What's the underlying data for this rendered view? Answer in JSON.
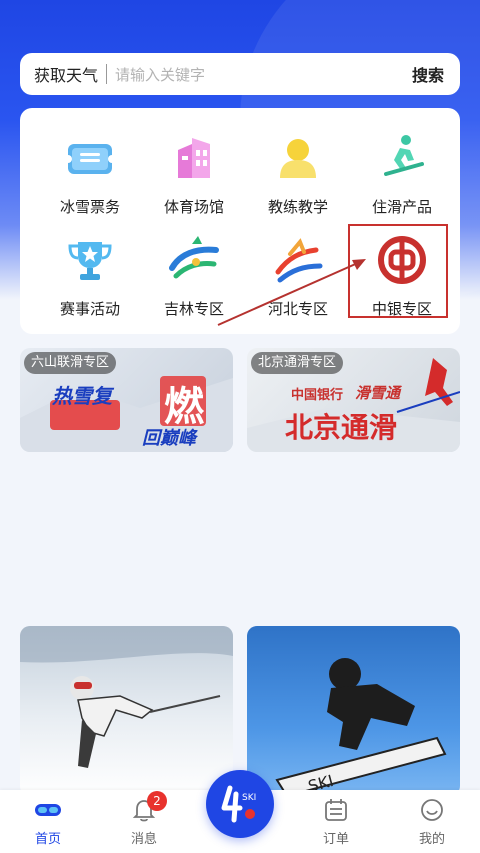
{
  "search": {
    "weather_label": "获取天气",
    "placeholder": "请输入关键字",
    "button_label": "搜索"
  },
  "grid": {
    "items": [
      {
        "label": "冰雪票务",
        "icon": "ticket-icon"
      },
      {
        "label": "体育场馆",
        "icon": "stadium-icon"
      },
      {
        "label": "教练教学",
        "icon": "coach-icon"
      },
      {
        "label": "住滑产品",
        "icon": "skier-icon"
      },
      {
        "label": "赛事活动",
        "icon": "trophy-icon"
      },
      {
        "label": "吉林专区",
        "icon": "jilin-logo-icon"
      },
      {
        "label": "河北专区",
        "icon": "hebei-logo-icon"
      },
      {
        "label": "中银专区",
        "icon": "boc-logo-icon"
      }
    ]
  },
  "banners": [
    {
      "tag": "六山联滑专区",
      "line1": "热雪复",
      "line2": "燃",
      "line3": "回巅峰"
    },
    {
      "tag": "北京通滑专区",
      "line1": "中国银行",
      "line2": "滑雪通",
      "line3": "北京通滑"
    }
  ],
  "tabbar": {
    "tabs": [
      {
        "label": "首页",
        "icon": "goggles-icon",
        "active": true
      },
      {
        "label": "消息",
        "icon": "bell-icon",
        "badge": "2"
      },
      {
        "label": "订单",
        "icon": "calendar-icon"
      },
      {
        "label": "我的",
        "icon": "smile-icon"
      }
    ],
    "center_label": "SKI"
  },
  "colors": {
    "brand_blue": "#1f46e4",
    "highlight_red": "#c8312e",
    "badge_red": "#e8322d"
  }
}
